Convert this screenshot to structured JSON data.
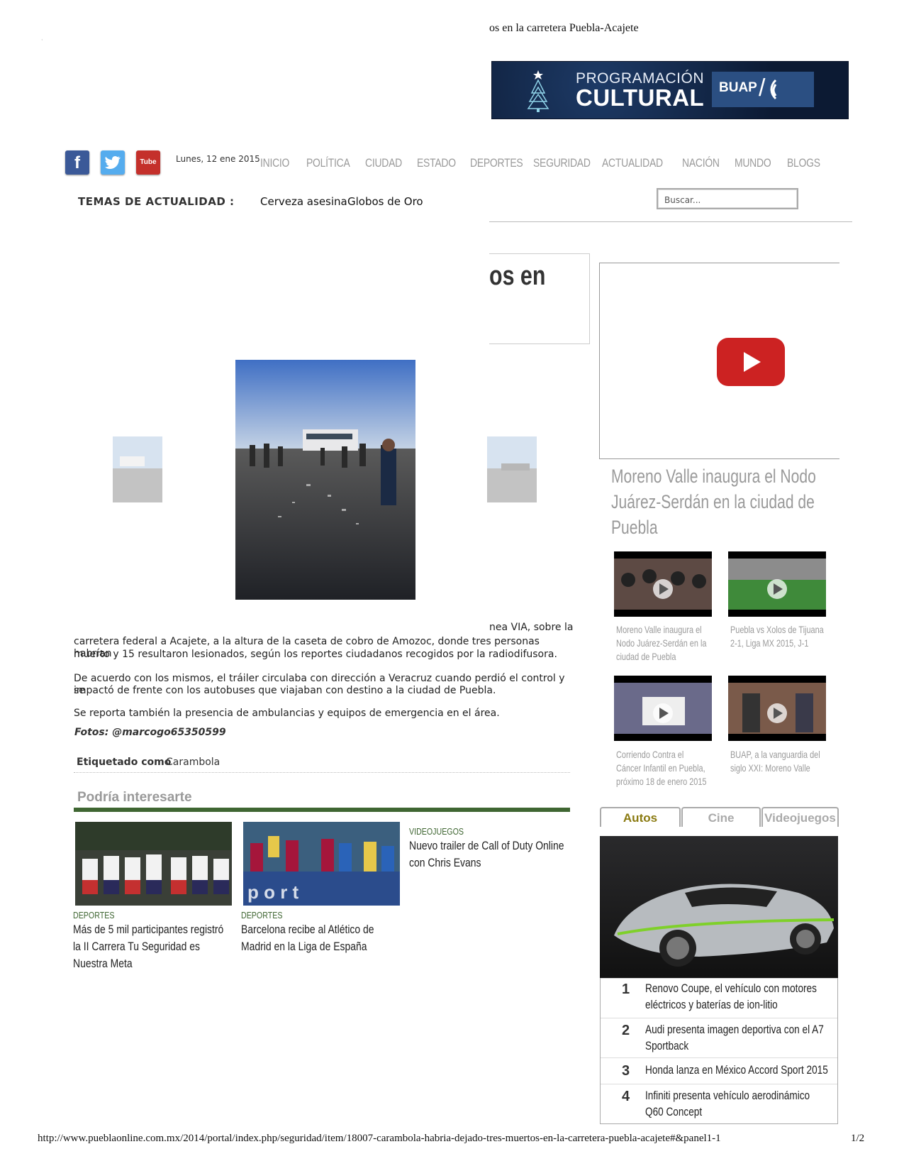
{
  "print_header": {
    "title_fragment": "os en la carretera Puebla-Acajete"
  },
  "print_footer": {
    "url": "http://www.pueblaonline.com.mx/2014/portal/index.php/seguridad/item/18007-carambola-habria-dejado-tres-muertos-en-la-carretera-puebla-acajete#&panel1-1",
    "page": "1/2"
  },
  "banner": {
    "line1": "PROGRAMACIÓN",
    "line2": "CULTURAL",
    "brand": "BUAP"
  },
  "social": [
    {
      "label": "f",
      "icon": "facebook-icon"
    },
    {
      "label": "t",
      "icon": "twitter-icon"
    },
    {
      "label": "Tube",
      "icon": "youtube-icon"
    }
  ],
  "date": "Lunes, 12 ene 2015",
  "nav": [
    "INICIO",
    "POLÍTICA",
    "CIUDAD",
    "ESTADO",
    "DEPORTES",
    "SEGURIDAD",
    "ACTUALIDAD",
    "NACIÓN",
    "MUNDO",
    "BLOGS"
  ],
  "temas": {
    "label": "TEMAS DE ACTUALIDAD :",
    "items": [
      "Cerveza asesina",
      "Globos de Oro"
    ]
  },
  "search": {
    "placeholder": "Buscar..."
  },
  "article": {
    "title_fragment": "os en",
    "p1_fragment": "nea VIA, sobre la",
    "p1_lines": [
      "carretera federal a Acajete, a la altura de la caseta de cobro de Amozoc, donde tres personas habrían",
      "muerto y 15 resultaron lesionados, según los reportes ciudadanos recogidos por la radiodifusora."
    ],
    "p2_lines": [
      "De acuerdo con los mismos, el tráiler circulaba con dirección a Veracruz cuando perdió el control y se",
      "impactó de frente con los autobuses que viajaban con destino a la ciudad de Puebla."
    ],
    "p3": "Se reporta también la presencia de ambulancias y equipos de emergencia en el área.",
    "photos": "Fotos: @marcogo65350599",
    "tag_label": "Etiquetado como",
    "tag_value": "Carambola"
  },
  "related": {
    "heading": "Podría interesarte",
    "items": [
      {
        "category": "DEPORTES",
        "title_lines": [
          "Más de 5 mil participantes registró",
          "la II Carrera Tu Seguridad es",
          "Nuestra Meta"
        ]
      },
      {
        "category": "DEPORTES",
        "title_lines": [
          "Barcelona recibe al Atlético de",
          "Madrid en la Liga de España"
        ]
      },
      {
        "category": "VIDEOJUEGOS",
        "title_lines": [
          "Nuevo trailer de Call of Duty Online",
          "con Chris Evans"
        ]
      }
    ]
  },
  "sidebar": {
    "video_title_lines": [
      "Moreno Valle inaugura el Nodo",
      "Juárez-Serdán en la ciudad de",
      "Puebla"
    ],
    "videos": [
      {
        "caption_lines": [
          "Moreno Valle inaugura el",
          "Nodo Juárez-Serdán en la",
          "ciudad de Puebla"
        ]
      },
      {
        "caption_lines": [
          "Puebla vs Xolos de Tijuana",
          "2-1, Liga MX 2015, J-1"
        ]
      },
      {
        "caption_lines": [
          "Corriendo Contra el",
          "Cáncer Infantil en Puebla,",
          "próximo 18 de enero 2015"
        ]
      },
      {
        "caption_lines": [
          "BUAP, a la vanguardia del",
          "siglo XXI: Moreno Valle"
        ]
      }
    ],
    "tabs": [
      "Autos",
      "Cine",
      "Videojuegos"
    ],
    "ranking": [
      {
        "num": "1",
        "lines": [
          "Renovo Coupe, el vehículo con motores",
          "eléctricos y baterías de ion-litio"
        ]
      },
      {
        "num": "2",
        "lines": [
          "Audi presenta imagen deportiva con el A7",
          "Sportback"
        ]
      },
      {
        "num": "3",
        "lines": [
          "Honda lanza en México Accord Sport 2015"
        ]
      },
      {
        "num": "4",
        "lines": [
          "Infiniti presenta vehículo aerodinámico",
          "Q60 Concept"
        ]
      }
    ]
  },
  "colors": {
    "accent_green": "#3f6632",
    "youtube_red": "#cc2222",
    "nav_gray": "#9a9a9a"
  }
}
